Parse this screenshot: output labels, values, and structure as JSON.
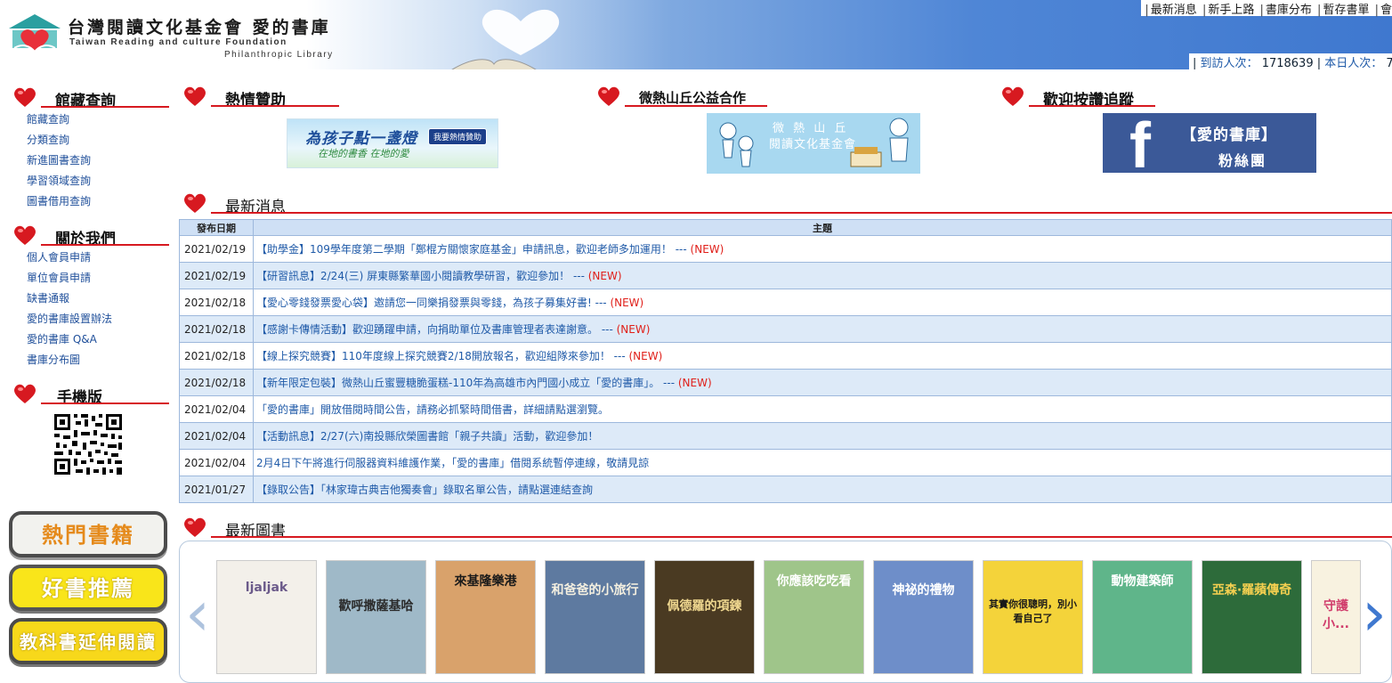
{
  "header": {
    "title": "台灣閱讀文化基金會  愛的書庫",
    "subtitle_en": "Taiwan Reading and culture Foundation",
    "subtitle_en2": "Philanthropic Library",
    "top_links": [
      "最新消息",
      "新手上路",
      "書庫分布",
      "暫存書單",
      "會"
    ],
    "visits_label": "到訪人次：",
    "visits_count": "1718639",
    "today_label": "本日人次：",
    "today_count": "7"
  },
  "sidebar": {
    "catalog": {
      "title": "館藏查詢",
      "items": [
        "館藏查詢",
        "分類查詢",
        "新進圖書查詢",
        "學習領域查詢",
        "圖書借用查詢"
      ]
    },
    "about": {
      "title": "關於我們",
      "items": [
        "個人會員申請",
        "單位會員申請",
        "缺書通報",
        "愛的書庫設置辦法",
        "愛的書庫 Q&A",
        "書庫分布圖"
      ]
    },
    "mobile": {
      "title": "手機版"
    },
    "pills": [
      "熱門書籍",
      "好書推薦",
      "教科書延伸閱讀"
    ]
  },
  "sections": {
    "support": "熱情贊助",
    "hill": "微熱山丘公益合作",
    "facebook": "歡迎按讚追蹤",
    "news": "最新消息",
    "books": "最新圖書"
  },
  "banners": {
    "support_main": "為孩子點一盞燈",
    "support_sub": "在地的書香  在地的愛",
    "support_btn": "我要熱情贊助",
    "hill_1": "微 熱 山 丘",
    "hill_2": "閱讀文化基金會",
    "fb_1": "【愛的書庫】",
    "fb_2": "粉絲團"
  },
  "news": {
    "headers": {
      "date": "發布日期",
      "subject": "主題"
    },
    "new_tag": "(NEW)",
    "rows": [
      {
        "date": "2021/02/19",
        "text": "【助學金】109學年度第二學期「鄭棍方關懷家庭基金」申請訊息，歡迎老師多加運用！ --- ",
        "is_new": true
      },
      {
        "date": "2021/02/19",
        "text": "【研習訊息】2/24(三) 屏東縣繁華國小閱讀教學研習，歡迎參加！ --- ",
        "is_new": true
      },
      {
        "date": "2021/02/18",
        "text": "【愛心零錢發票愛心袋】邀請您一同樂捐發票與零錢，為孩子募集好書! --- ",
        "is_new": true
      },
      {
        "date": "2021/02/18",
        "text": "【感謝卡傳情活動】歡迎踴躍申請，向捐助單位及書庫管理者表達謝意。 --- ",
        "is_new": true
      },
      {
        "date": "2021/02/18",
        "text": "【線上探究競賽】110年度線上探究競賽2/18開放報名，歡迎組隊來參加！ --- ",
        "is_new": true
      },
      {
        "date": "2021/02/18",
        "text": "【新年限定包裝】微熱山丘蜜豐糖脆蛋糕-110年為高雄市內門國小成立「愛的書庫」。 --- ",
        "is_new": true
      },
      {
        "date": "2021/02/04",
        "text": "「愛的書庫」開放借閱時間公告，請務必抓緊時間借書，詳細請點選瀏覽。",
        "is_new": false
      },
      {
        "date": "2021/02/04",
        "text": "【活動訊息】2/27(六)南投縣欣榮圖書館「親子共讀」活動，歡迎參加！",
        "is_new": false
      },
      {
        "date": "2021/02/04",
        "text": "2月4日下午將進行伺服器資料維護作業，「愛的書庫」借閱系統暫停連線，敬請見諒",
        "is_new": false
      },
      {
        "date": "2021/01/27",
        "text": "【錄取公告】「林家瑋古典吉他獨奏會」錄取名單公告，請點選連結查詢",
        "is_new": false
      }
    ]
  },
  "books": [
    {
      "title": "ljaljak",
      "bg": "#f3f0ea",
      "fg": "#6b5a8a"
    },
    {
      "title": "歡呼撒薩基哈",
      "bg": "#9fb9c8",
      "fg": "#2a2a2a"
    },
    {
      "title": "來基隆樂港",
      "bg": "#d9a26b",
      "fg": "#1a1a1a"
    },
    {
      "title": "和爸爸的小旅行",
      "bg": "#5e7aa0",
      "fg": "#f5f0e0"
    },
    {
      "title": "佩德羅的項鍊",
      "bg": "#4a3a22",
      "fg": "#f0d890"
    },
    {
      "title": "你應該吃吃看",
      "bg": "#9fc58a",
      "fg": "#fff"
    },
    {
      "title": "神祕的禮物",
      "bg": "#6e8ec9",
      "fg": "#fff"
    },
    {
      "title": "其實你很聰明，別小看自己了",
      "bg": "#f4d33a",
      "fg": "#1a1a1a"
    },
    {
      "title": "動物建築師",
      "bg": "#5fb58a",
      "fg": "#fff"
    },
    {
      "title": "亞森·羅蘋傳奇",
      "bg": "#2d6b3a",
      "fg": "#f5d050"
    },
    {
      "title": "守護小...",
      "bg": "#f8f2e0",
      "fg": "#d03a6a"
    }
  ],
  "colors": {
    "accent_red": "#d71920",
    "link_blue": "#1f5aa8",
    "fb_blue": "#3b5998"
  }
}
